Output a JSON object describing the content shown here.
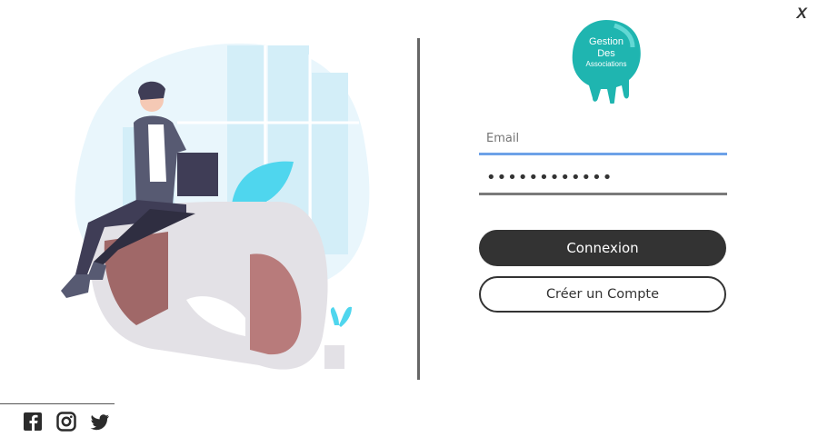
{
  "window": {
    "close_label": "X"
  },
  "logo": {
    "line1": "Gestion",
    "line2": "Des",
    "line3": "Associations"
  },
  "form": {
    "email_placeholder": "Email",
    "password_value": "••••••••••••",
    "login_label": "Connexion",
    "register_label": "Créer un Compte"
  },
  "social": {
    "icons": [
      "facebook-icon",
      "instagram-icon",
      "twitter-icon"
    ]
  },
  "colors": {
    "accent_blue": "#6da1e8",
    "button_dark": "#333333",
    "logo_teal": "#1fb5b0"
  }
}
